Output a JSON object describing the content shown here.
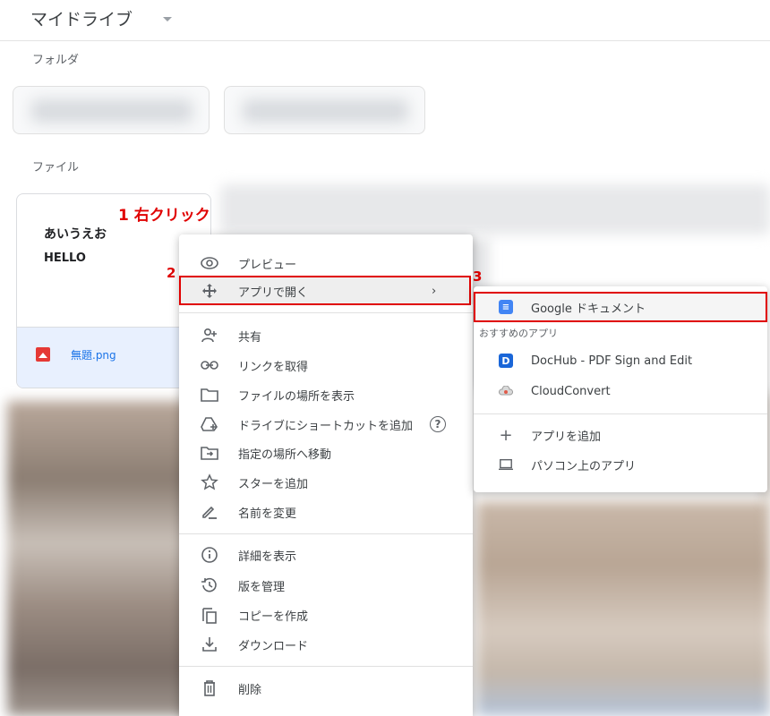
{
  "header": {
    "title": "マイドライブ"
  },
  "sections": {
    "folders": "フォルダ",
    "files": "ファイル"
  },
  "file": {
    "preview_line1": "あいうえお",
    "preview_line2": "HELLO",
    "name": "無題.png"
  },
  "annotations": {
    "step1": "1 右クリック",
    "step2": "2",
    "step3": "3"
  },
  "context_menu": {
    "items": [
      {
        "icon": "eye-icon",
        "label": "プレビュー"
      },
      {
        "icon": "move-arrows-icon",
        "label": "アプリで開く"
      },
      {
        "icon": "person-add-icon",
        "label": "共有"
      },
      {
        "icon": "link-icon",
        "label": "リンクを取得"
      },
      {
        "icon": "folder-icon",
        "label": "ファイルの場所を表示"
      },
      {
        "icon": "drive-shortcut-icon",
        "label": "ドライブにショートカットを追加"
      },
      {
        "icon": "move-to-folder-icon",
        "label": "指定の場所へ移動"
      },
      {
        "icon": "star-icon",
        "label": "スターを追加"
      },
      {
        "icon": "pencil-icon",
        "label": "名前を変更"
      },
      {
        "icon": "info-icon",
        "label": "詳細を表示"
      },
      {
        "icon": "history-icon",
        "label": "版を管理"
      },
      {
        "icon": "copy-icon",
        "label": "コピーを作成"
      },
      {
        "icon": "download-icon",
        "label": "ダウンロード"
      },
      {
        "icon": "trash-icon",
        "label": "削除"
      }
    ]
  },
  "submenu": {
    "google_docs": "Google ドキュメント",
    "recommended_header": "おすすめのアプリ",
    "docs_icon_glyph": "≡",
    "dochub": "DocHub - PDF Sign and Edit",
    "dochub_icon_glyph": "D",
    "cloudconvert": "CloudConvert",
    "add_app": "アプリを追加",
    "desktop_apps": "パソコン上のアプリ"
  },
  "colors": {
    "accent_red": "#e00000",
    "docs_blue": "#4285f4",
    "dochub_blue": "#1a66d8",
    "selected_bg": "#e8f0fe"
  }
}
